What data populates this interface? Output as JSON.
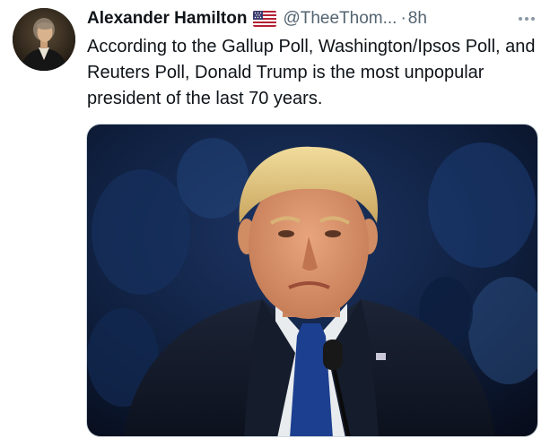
{
  "tweet": {
    "author_name": "Alexander Hamilton",
    "flag_icon": "us-flag-icon",
    "handle": "@TheeThom...",
    "separator": "·",
    "time": "8h",
    "more_icon": "more-options-icon",
    "text": "According to the Gallup Poll, Washington/Ipsos Poll, and Reuters Poll, Donald Trump is the most unpopular president of the last 70 years."
  },
  "colors": {
    "text_primary": "#0f1419",
    "text_secondary": "#536471",
    "media_border": "#cfd9de"
  }
}
